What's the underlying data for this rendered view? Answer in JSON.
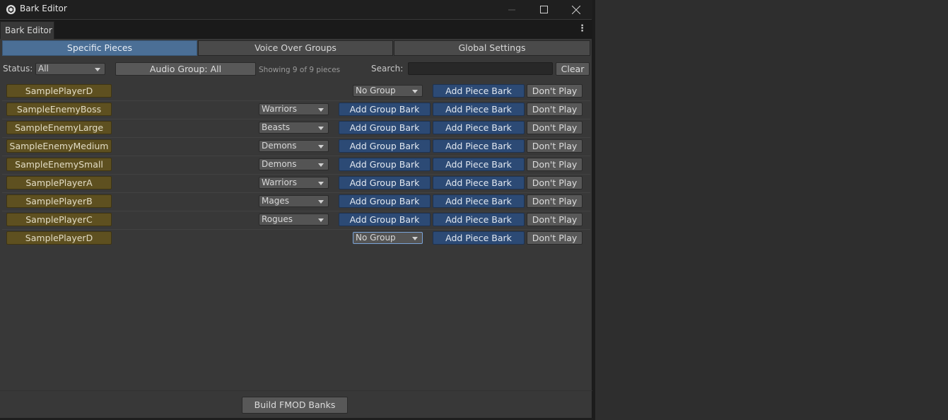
{
  "window": {
    "title": "Bark Editor"
  },
  "dock": {
    "tab_label": "Bark Editor"
  },
  "tabs": [
    {
      "label": "Specific Pieces",
      "active": true
    },
    {
      "label": "Voice Over Groups",
      "active": false
    },
    {
      "label": "Global Settings",
      "active": false
    }
  ],
  "filters": {
    "status_label": "Status:",
    "status_value": "All",
    "audio_group_button": "Audio Group: All",
    "showing_text": "Showing 9 of 9 pieces",
    "search_label": "Search:",
    "search_value": "",
    "clear_button": "Clear"
  },
  "rows": [
    {
      "piece": "SamplePlayerD",
      "group": "",
      "add_group": "",
      "vo_group": "No Group",
      "add_piece": "Add Piece Bark",
      "dont_play": "Don't Play"
    },
    {
      "piece": "SampleEnemyBoss",
      "group": "Warriors",
      "add_group": "Add Group Bark",
      "vo_group": "",
      "add_piece": "Add Piece Bark",
      "dont_play": "Don't Play"
    },
    {
      "piece": "SampleEnemyLarge",
      "group": "Beasts",
      "add_group": "Add Group Bark",
      "vo_group": "",
      "add_piece": "Add Piece Bark",
      "dont_play": "Don't Play"
    },
    {
      "piece": "SampleEnemyMedium",
      "group": "Demons",
      "add_group": "Add Group Bark",
      "vo_group": "",
      "add_piece": "Add Piece Bark",
      "dont_play": "Don't Play"
    },
    {
      "piece": "SampleEnemySmall",
      "group": "Demons",
      "add_group": "Add Group Bark",
      "vo_group": "",
      "add_piece": "Add Piece Bark",
      "dont_play": "Don't Play"
    },
    {
      "piece": "SamplePlayerA",
      "group": "Warriors",
      "add_group": "Add Group Bark",
      "vo_group": "",
      "add_piece": "Add Piece Bark",
      "dont_play": "Don't Play"
    },
    {
      "piece": "SamplePlayerB",
      "group": "Mages",
      "add_group": "Add Group Bark",
      "vo_group": "",
      "add_piece": "Add Piece Bark",
      "dont_play": "Don't Play"
    },
    {
      "piece": "SamplePlayerC",
      "group": "Rogues",
      "add_group": "Add Group Bark",
      "vo_group": "",
      "add_piece": "Add Piece Bark",
      "dont_play": "Don't Play"
    },
    {
      "piece": "SamplePlayerD",
      "group": "",
      "add_group": "",
      "vo_group": "No Group",
      "add_piece": "Add Piece Bark",
      "dont_play": "Don't Play"
    }
  ],
  "footer": {
    "build_button": "Build FMOD Banks"
  },
  "colors": {
    "active_tab": "#4b6f96",
    "action_blue": "#2c4a75",
    "piece_gold": "#5e5020"
  }
}
